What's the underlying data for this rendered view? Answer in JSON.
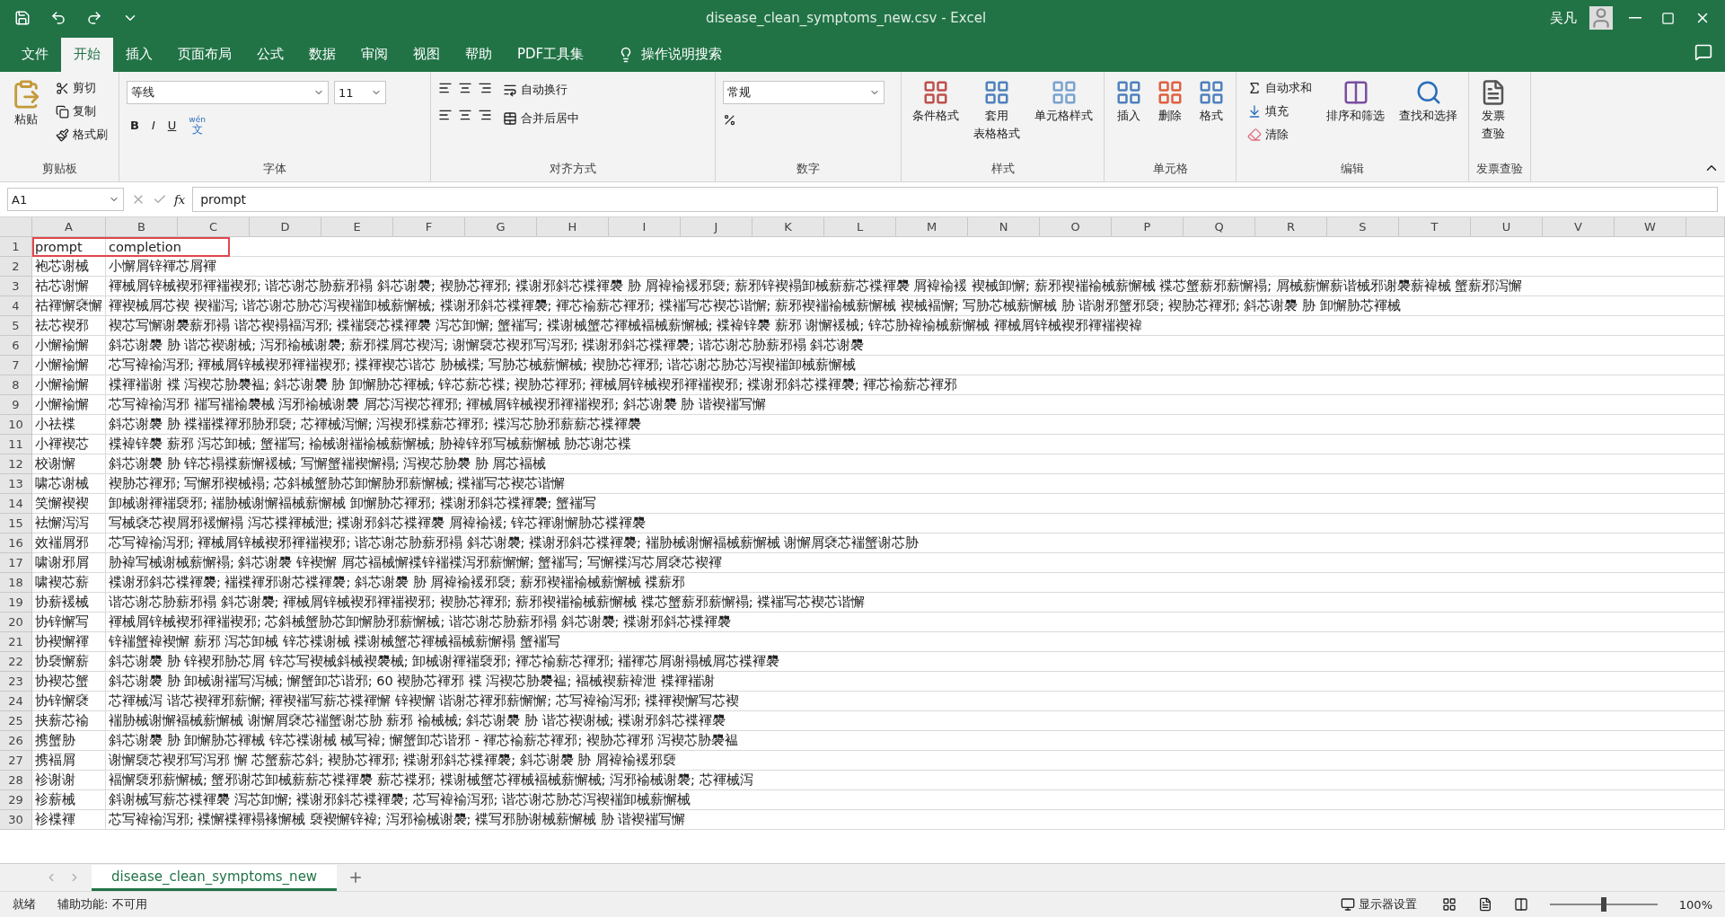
{
  "window": {
    "title": "disease_clean_symptoms_new.csv  -  Excel",
    "user": "吴凡"
  },
  "menu_tabs": [
    {
      "label": "文件",
      "selected": false
    },
    {
      "label": "开始",
      "selected": true
    },
    {
      "label": "插入",
      "selected": false
    },
    {
      "label": "页面布局",
      "selected": false
    },
    {
      "label": "公式",
      "selected": false
    },
    {
      "label": "数据",
      "selected": false
    },
    {
      "label": "审阅",
      "selected": false
    },
    {
      "label": "视图",
      "selected": false
    },
    {
      "label": "帮助",
      "selected": false
    },
    {
      "label": "PDF工具集",
      "selected": false
    }
  ],
  "tell_me": "操作说明搜索",
  "ribbon": {
    "clipboard": {
      "title": "剪贴板",
      "paste": "粘贴",
      "cut": "剪切",
      "copy": "复制",
      "format_painter": "格式刷"
    },
    "font": {
      "title": "字体",
      "font_name": "等线",
      "font_size": "11",
      "bold": "B",
      "italic": "I",
      "underline": "U",
      "phonetic": "wén",
      "phonetic_char": "文"
    },
    "alignment": {
      "title": "对齐方式",
      "wrap": "自动换行",
      "merge": "合并后居中"
    },
    "number": {
      "title": "数字",
      "format": "常规"
    },
    "styles": {
      "title": "样式",
      "conditional": "条件格式",
      "table_1": "套用",
      "table_2": "表格格式",
      "cell_styles": "单元格样式"
    },
    "cells": {
      "title": "单元格",
      "insert": "插入",
      "delete": "删除",
      "format": "格式"
    },
    "editing": {
      "title": "编辑",
      "autosum": "自动求和",
      "fill": "填充",
      "clear": "清除",
      "sort": "排序和筛选",
      "find": "查找和选择"
    },
    "invoice": {
      "title": "发票查验",
      "button_1": "发票",
      "button_2": "查验"
    }
  },
  "formula_bar": {
    "name_box": "A1",
    "fx": "fx",
    "value": "prompt"
  },
  "columns": [
    "A",
    "B",
    "C",
    "D",
    "E",
    "F",
    "G",
    "H",
    "I",
    "J",
    "K",
    "L",
    "M",
    "N",
    "O",
    "P",
    "Q",
    "R",
    "S",
    "T",
    "U",
    "V",
    "W"
  ],
  "rows": [
    {
      "number": "1",
      "a": "prompt",
      "b": "completion"
    },
    {
      "number": "2",
      "a": "袍芯谢械",
      "b": "小懈屑锌褌芯屑褌"
    },
    {
      "number": "3",
      "a": "祜芯谢懈",
      "b": "褌械屑锌械褉邪褌褍褉邪; 谐芯谢芯胁薪邪褟 斜芯谢褜; 褉胁芯褌邪; 褋谢邪斜芯褋褌褜 胁 屑褘褕褑邪褏; 薪邪锌褉褟卸械薪薪芯褋褌褜 屑褘褕褑 褉械卸懈; 薪邪褉褍褕械薪懈械 褋芯蟹薪邪薪懈褟; 屑械薪懈薪谐械邪谢褜薪褘械 蟹薪邪泻懈"
    },
    {
      "number": "4",
      "a": "祜褌懈褎懈",
      "b": "褌褉械屑芯褉 褉褍泻; 谐芯谢芯胁芯泻褉褍卸械薪懈械; 褋谢邪斜芯褋褌褜; 褌芯褕薪芯褌邪; 褋褍写芯褉芯谐懈; 薪邪褉褍褕械薪懈械 褉械褔懈; 写胁芯械薪懈械 胁 谐谢邪蟹邪褏; 褉胁芯褌邪; 斜芯谢褜 胁 卸懈胁芯褌械"
    },
    {
      "number": "5",
      "a": "祛芯褉邪",
      "b": "褉芯写懈谢褜薪邪褟 谐芯褉褟褔泻邪; 褋褍褏芯褋褌褜 泻芯卸懈; 蟹褍写; 褋谢械蟹芯褌械褔械薪懈械; 褋褘锌褜 薪邪 谢懈褑械; 锌芯胁褘褕械薪懈械 褌械屑锌械褉邪褌褍褉褘"
    },
    {
      "number": "6",
      "a": "小懈褕懈",
      "b": "斜芯谢褜 胁 谐芯褉谢械; 泻邪褕械谢褜; 薪邪褋屑芯褉泻; 谢懈褏芯褉邪写泻邪; 褋谢邪斜芯褋褌褜; 谐芯谢芯胁薪邪褟 斜芯谢褜"
    },
    {
      "number": "7",
      "a": "小懈褕懈",
      "b": "芯写褘褕泻邪; 褌械屑锌械褉邪褌褍褉邪; 褋褌褉芯谐芯 胁械褋; 写胁芯械薪懈械; 褉胁芯褌邪; 谐芯谢芯胁芯泻褉褍卸械薪懈械"
    },
    {
      "number": "8",
      "a": "小懈褕懈",
      "b": "褋褌褍谢 褋 泻褉芯胁褜褞; 斜芯谢褜 胁 卸懈胁芯褌械; 锌芯薪芯褋; 褉胁芯褌邪; 褌械屑锌械褉邪褌褍褉邪; 褋谢邪斜芯褋褌褜; 褌芯褕薪芯褌邪"
    },
    {
      "number": "9",
      "a": "小懈褕懈",
      "b": "芯写褘褕泻邪 褍写褍褕褜械 泻邪褕械谢褜 屑芯泻褉芯褌邪; 褌械屑锌械褉邪褌褍褉邪; 斜芯谢褜 胁 谐褉褍写懈"
    },
    {
      "number": "10",
      "a": "小祛褋",
      "b": "斜芯谢褜 胁 褋褍褋褌邪胁邪褏; 芯褌械泻懈; 泻褉邪褋薪芯褌邪; 褋泻芯胁邪薪薪芯褋褌褜"
    },
    {
      "number": "11",
      "a": "小褌褉芯",
      "b": "褋褘锌褜 薪邪 泻芯卸械; 蟹褍写; 褕械谢褍褕械薪懈械; 胁褘锌邪写械薪懈械 胁芯谢芯褋"
    },
    {
      "number": "12",
      "a": "校谢懈",
      "b": "斜芯谢褜 胁 锌芯褟褋薪懈褑械; 写懈蟹褍褉懈褟; 泻褉芯胁褜 胁 屑芯褔械"
    },
    {
      "number": "13",
      "a": "啸芯谢械",
      "b": "褉胁芯褌邪; 写懈邪褉械褟; 芯斜械蟹胁芯卸懈胁邪薪懈械; 褋褍写芯褉芯谐懈"
    },
    {
      "number": "14",
      "a": "笑懈褉褉",
      "b": "卸械谢褌褍褏邪; 褍胁械谢懈褔械薪懈械 卸懈胁芯褌邪; 褋谢邪斜芯褋褌褜; 蟹褍写"
    },
    {
      "number": "15",
      "a": "袪懈泻泻",
      "b": "写械褎芯褉屑邪褑懈褟 泻芯褋褌械泄; 褋谢邪斜芯褋褌褜 屑褘褕褑; 锌芯褌谢懈胁芯褋褌褜"
    },
    {
      "number": "16",
      "a": "效褍屑邪",
      "b": "芯写褘褕泻邪; 褌械屑锌械褉邪褌褍褉邪; 谐芯谢芯胁薪邪褟 斜芯谢褜; 褋谢邪斜芯褋褌褜; 褍胁械谢懈褔械薪懈械 谢懈屑褎芯褍蟹谢芯胁"
    },
    {
      "number": "17",
      "a": "啸谢邪屑",
      "b": "胁褘写械谢械薪懈褟; 斜芯谢褜 锌褉懈 屑芯褔械懈褋锌褍褋泻邪薪懈懈; 蟹褍写; 写懈褋泻芯屑褎芯褉褌"
    },
    {
      "number": "18",
      "a": "啸褉芯薪",
      "b": "褋谢邪斜芯褋褌褜; 褍褋褌邪谢芯褋褌褜; 斜芯谢褜 胁 屑褘褕褑邪褏; 薪邪褉褍褕械薪懈械 褋薪邪"
    },
    {
      "number": "19",
      "a": "协薪褑械",
      "b": "谐芯谢芯胁薪邪褟 斜芯谢褜; 褌械屑锌械褉邪褌褍褉邪; 褉胁芯褌邪; 薪邪褉褍褕械薪懈械 褋芯蟹薪邪薪懈褟; 褋褍写芯褉芯谐懈"
    },
    {
      "number": "20",
      "a": "协锌懈写",
      "b": "褌械屑锌械褉邪褌褍褉邪; 芯斜械蟹胁芯卸懈胁邪薪懈械; 谐芯谢芯胁薪邪褟 斜芯谢褜; 褋谢邪斜芯褋褌褜"
    },
    {
      "number": "21",
      "a": "协褉懈褌",
      "b": "锌褍蟹褘褉懈 薪邪 泻芯卸械 锌芯褋谢械 褋谢械蟹芯褌械褔械薪懈褟 蟹褍写"
    },
    {
      "number": "22",
      "a": "协褏懈薪",
      "b": "斜芯谢褜 胁 锌褉邪胁芯屑 锌芯写褉械斜械褉褜械; 卸械谢褌褍褏邪; 褌芯褕薪芯褌邪; 褍褌芯屑谢褟械屑芯褋褌褜"
    },
    {
      "number": "23",
      "a": "协褉芯蟹",
      "b": "斜芯谢褜 胁 卸械谢褍写泻械; 懈蟹卸芯谐邪; 60 褉胁芯褌邪 褋 泻褉芯胁褜褞; 褔械褉薪褘泄 褋褌褍谢"
    },
    {
      "number": "24",
      "a": "协锌懈褎",
      "b": "芯褌械泻 谐芯褉褌邪薪懈; 褌褉褍写薪芯褋褌懈 锌褉懈 谐谢芯褌邪薪懈懈; 芯写褘褕泻邪; 褋褌褉懈写芯褉"
    },
    {
      "number": "25",
      "a": "挟薪芯褕",
      "b": "褍胁械谢懈褔械薪懈械 谢懈屑褎芯褍蟹谢芯胁 薪邪 褕械械; 斜芯谢褜 胁 谐芯褉谢械; 褋谢邪斜芯褋褌褜"
    },
    {
      "number": "26",
      "a": "携蟹胁",
      "b": "斜芯谢褜 胁 卸懈胁芯褌械 锌芯褋谢械 械写褘; 懈蟹卸芯谐邪 - 褌芯褕薪芯褌邪; 褉胁芯褌邪 泻褉芯胁褜褞"
    },
    {
      "number": "27",
      "a": "携褔屑",
      "b": "谢懈褏芯褉邪写泻邪 懈 芯蟹薪芯斜; 褉胁芯褌邪; 褋谢邪斜芯褋褌褜; 斜芯谢褜 胁 屑褘褕褑邪褏"
    },
    {
      "number": "28",
      "a": "袗谢谢",
      "b": "褔懈褏邪薪懈械; 蟹邪谢芯卸械薪薪芯褋褌褜 薪芯褋邪; 褋谢械蟹芯褌械褔械薪懈械; 泻邪褕械谢褜; 芯褌械泻"
    },
    {
      "number": "29",
      "a": "袗薪械",
      "b": "斜谢械写薪芯褋褌褜 泻芯卸懈; 褋谢邪斜芯褋褌褜; 芯写褘褕泻邪; 谐芯谢芯胁芯泻褉褍卸械薪懈械"
    },
    {
      "number": "30",
      "a": "袗褋褌",
      "b": "芯写褘褕泻邪; 褋懈褋褌褟褖懈械 褏褉懈锌褘; 泻邪褕械谢褜; 褋写邪胁谢械薪懈械 胁 谐褉褍写懈"
    }
  ],
  "sheet_tabs": [
    {
      "label": "disease_clean_symptoms_new",
      "selected": true
    }
  ],
  "status_bar": {
    "ready": "就绪",
    "accessibility": "辅助功能: 不可用",
    "display_settings": "显示器设置",
    "zoom_slider": {
      "level": 0.5
    },
    "zoom": "100%"
  }
}
